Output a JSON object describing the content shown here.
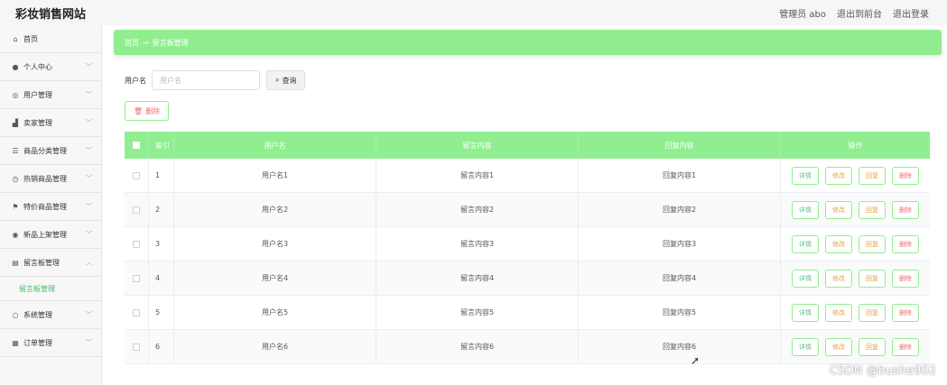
{
  "header": {
    "site_title": "彩妆销售网站",
    "admin_label": "管理员 abo",
    "to_front": "退出到前台",
    "logout": "退出登录"
  },
  "sidebar": {
    "items": [
      {
        "label": "首页",
        "icon": "home-icon",
        "glyph": "⌂"
      },
      {
        "label": "个人中心",
        "icon": "user-icon",
        "glyph": "●"
      },
      {
        "label": "用户管理",
        "icon": "users-icon",
        "glyph": "◎"
      },
      {
        "label": "卖家管理",
        "icon": "seller-icon",
        "glyph": "▟"
      },
      {
        "label": "商品分类管理",
        "icon": "list-icon",
        "glyph": "☰"
      },
      {
        "label": "热销商品管理",
        "icon": "clock-icon",
        "glyph": "◷"
      },
      {
        "label": "特价商品管理",
        "icon": "flag-icon",
        "glyph": "⚑"
      },
      {
        "label": "新品上架管理",
        "icon": "pin-icon",
        "glyph": "◉"
      },
      {
        "label": "留言板管理",
        "icon": "clipboard-icon",
        "glyph": "▤"
      },
      {
        "label": "系统管理",
        "icon": "settings-icon",
        "glyph": "○"
      },
      {
        "label": "订单管理",
        "icon": "grid-icon",
        "glyph": "▦"
      }
    ],
    "sub_item": "留言板管理"
  },
  "breadcrumb": {
    "home": "首页",
    "arrow": "→",
    "current": "留言板管理"
  },
  "search": {
    "label": "用户名",
    "placeholder": "用户名",
    "button": "查询"
  },
  "delete_button": "删除",
  "table": {
    "headers": [
      "索引",
      "用户名",
      "留言内容",
      "回复内容",
      "操作"
    ],
    "rows": [
      {
        "idx": "1",
        "user": "用户名1",
        "msg": "留言内容1",
        "reply": "回复内容1"
      },
      {
        "idx": "2",
        "user": "用户名2",
        "msg": "留言内容2",
        "reply": "回复内容2"
      },
      {
        "idx": "3",
        "user": "用户名3",
        "msg": "留言内容3",
        "reply": "回复内容3"
      },
      {
        "idx": "4",
        "user": "用户名4",
        "msg": "留言内容4",
        "reply": "回复内容4"
      },
      {
        "idx": "5",
        "user": "用户名5",
        "msg": "留言内容5",
        "reply": "回复内容5"
      },
      {
        "idx": "6",
        "user": "用户名6",
        "msg": "留言内容6",
        "reply": "回复内容6"
      }
    ],
    "ops": {
      "detail": "详情",
      "edit": "修改",
      "reply": "回复",
      "delete": "删除"
    }
  },
  "watermark": "CSDN @bushe902",
  "colors": {
    "accent": "#90ee90",
    "danger": "#f56c6c"
  }
}
